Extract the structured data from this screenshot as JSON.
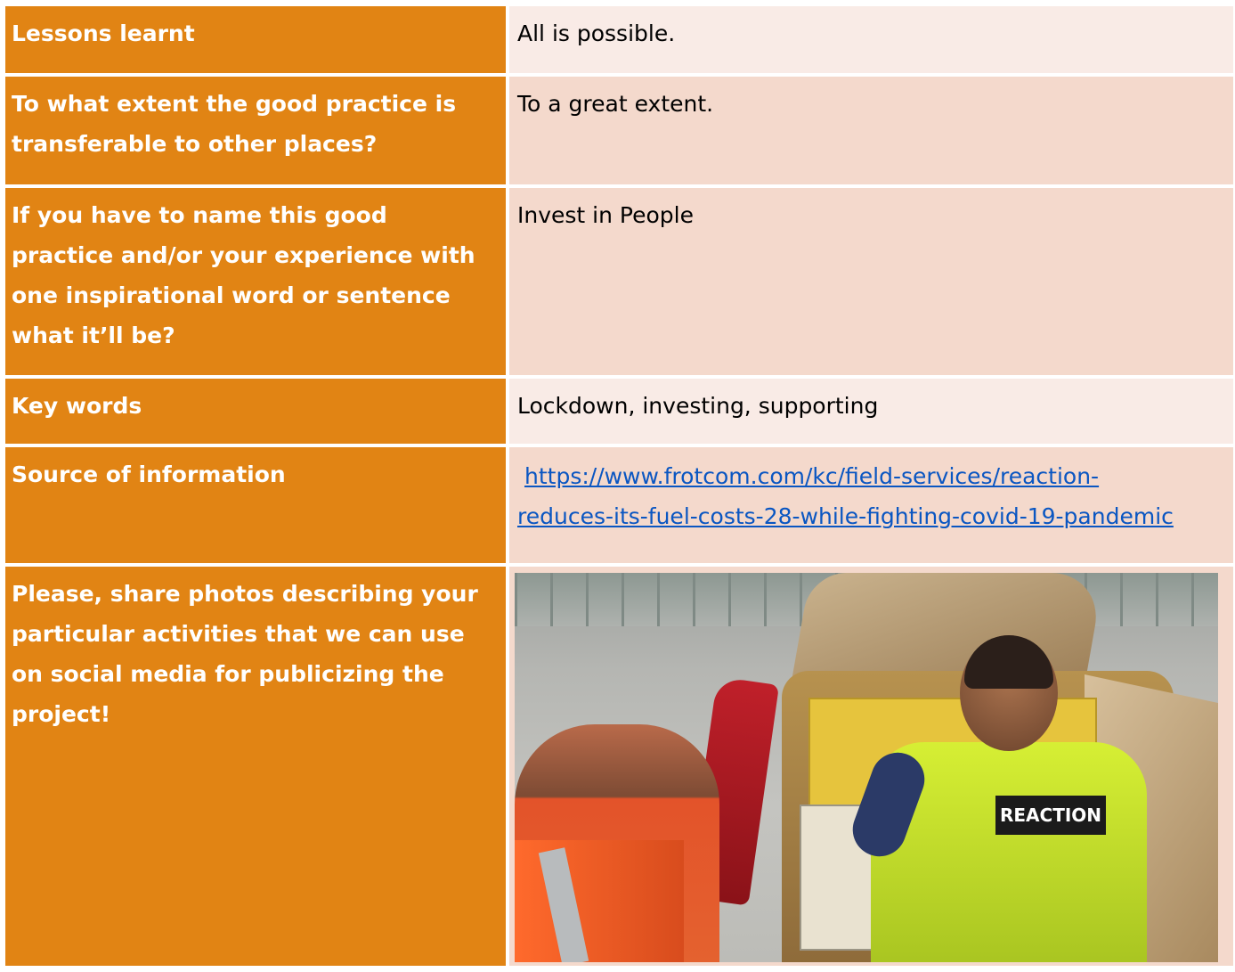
{
  "rows": [
    {
      "label": "Lessons learnt",
      "value": "All is possible."
    },
    {
      "label": "To what extent the good practice is transferable to other places?",
      "value": "To a great extent."
    },
    {
      "label": "If you have to name this good practice and/or your experience with one inspirational word or sentence what it’ll be?",
      "value": "Invest in People"
    },
    {
      "label": "Key words",
      "value": "Lockdown, investing, supporting"
    },
    {
      "label": "Source of information",
      "link_line1": "https://www.frotcom.com/kc/field-services/reaction-",
      "link_line2": "reduces-its-fuel-costs-28-while-fighting-covid-19-pandemic"
    },
    {
      "label": "Please, share photos describing your particular activities that we can use on social media for publicizing the project!",
      "photo_badge_text": "REACTION"
    }
  ],
  "colors": {
    "label_bg": "#e18414",
    "value_light": "#f9ebe6",
    "value_pink": "#f4d9cc",
    "link": "#0a56c2"
  }
}
